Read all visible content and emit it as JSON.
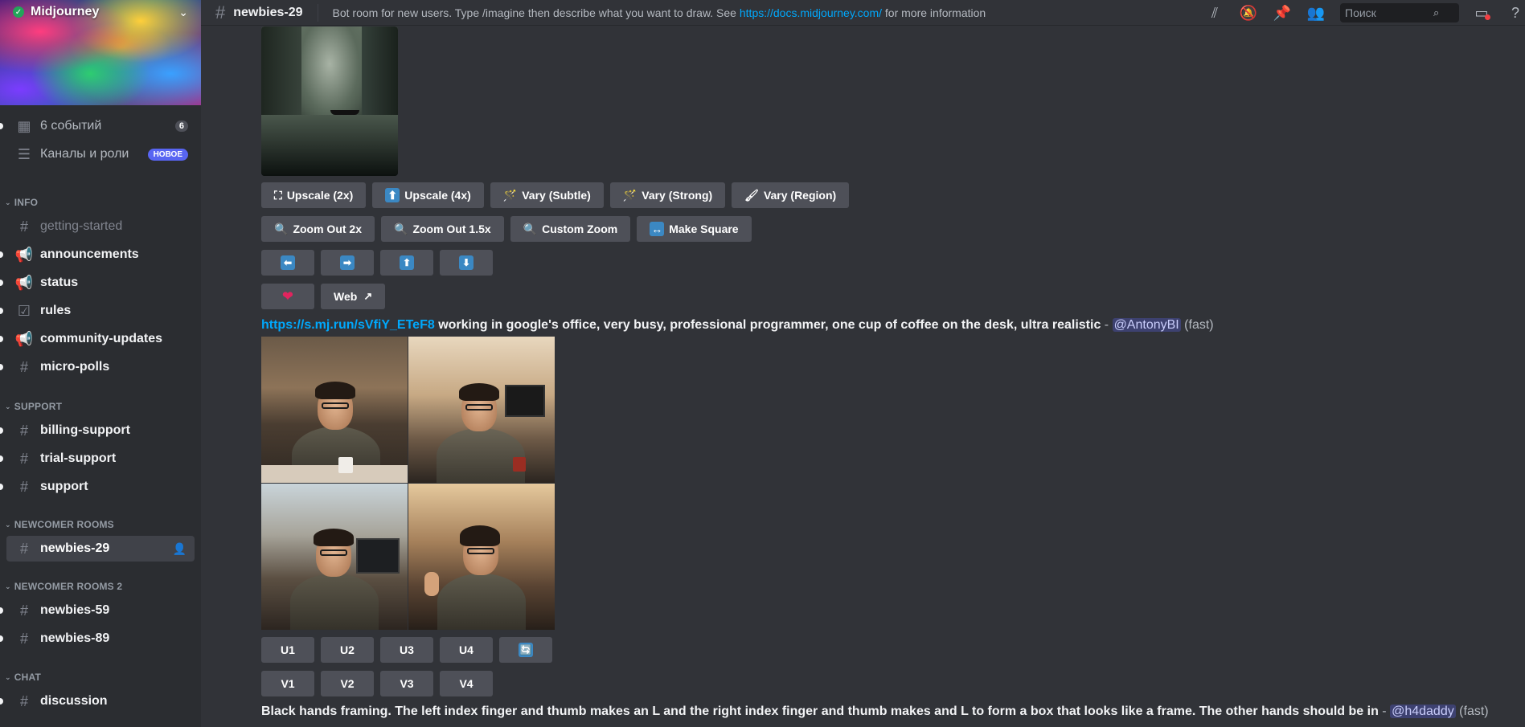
{
  "server": {
    "name": "Midjourney",
    "chevron": "⌄"
  },
  "sidebar": {
    "top_items": [
      {
        "label": "6 событий",
        "badge": "6",
        "icon": "calendar-icon"
      },
      {
        "label": "Каналы и роли",
        "badge": "НОВОЕ",
        "icon": "channels-roles-icon"
      }
    ],
    "categories": {
      "info": "INFO",
      "support": "SUPPORT",
      "newcomer": "NEWCOMER ROOMS",
      "newcomer2": "NEWCOMER ROOMS 2",
      "chat": "CHAT"
    },
    "info_channels": [
      "getting-started",
      "announcements",
      "status",
      "rules",
      "community-updates",
      "micro-polls"
    ],
    "support_channels": [
      "billing-support",
      "trial-support",
      "support"
    ],
    "newcomer_channels": [
      "newbies-29"
    ],
    "newcomer2_channels": [
      "newbies-59",
      "newbies-89"
    ],
    "chat_channels": [
      "discussion"
    ]
  },
  "topbar": {
    "channel": "newbies-29",
    "topic_before": "Bot room for new users. Type /imagine then describe what you want to draw. See ",
    "topic_link": "https://docs.midjourney.com/",
    "topic_after": " for more information",
    "search_placeholder": "Поиск"
  },
  "message1": {
    "buttons_row1": [
      {
        "label": "Upscale (2x)",
        "emoji": "⛶"
      },
      {
        "label": "Upscale (4x)",
        "emoji": "⬆"
      },
      {
        "label": "Vary (Subtle)",
        "emoji": "🪄"
      },
      {
        "label": "Vary (Strong)",
        "emoji": "🪄"
      },
      {
        "label": "Vary (Region)",
        "emoji": "🖌"
      }
    ],
    "buttons_row2": [
      {
        "label": "Zoom Out 2x",
        "emoji": "🔍"
      },
      {
        "label": "Zoom Out 1.5x",
        "emoji": "🔍"
      },
      {
        "label": "Custom Zoom",
        "emoji": "🔍"
      },
      {
        "label": "Make Square",
        "emoji": "↔"
      }
    ],
    "arrows": [
      "⬅",
      "➡",
      "⬆",
      "⬇"
    ],
    "heart": "❤",
    "web_label": "Web",
    "web_icon": "↗"
  },
  "message2": {
    "link": "https://s.mj.run/sVfiY_ETeF8",
    "prompt": " working in google's office, very busy, professional programmer, one cup of coffee on the desk, ultra realistic",
    "dash": " - ",
    "mention": "@AntonyBI",
    "speed": " (fast)",
    "u_buttons": [
      "U1",
      "U2",
      "U3",
      "U4"
    ],
    "reroll": "🔄",
    "v_buttons": [
      "V1",
      "V2",
      "V3",
      "V4"
    ]
  },
  "message3": {
    "prompt": "Black hands framing. The left index finger and thumb makes an L and the right index finger and thumb makes and L to form a box that looks like a frame. The other hands should be in",
    "dash": " - ",
    "mention": "@h4daddy",
    "speed": " (fast)"
  }
}
